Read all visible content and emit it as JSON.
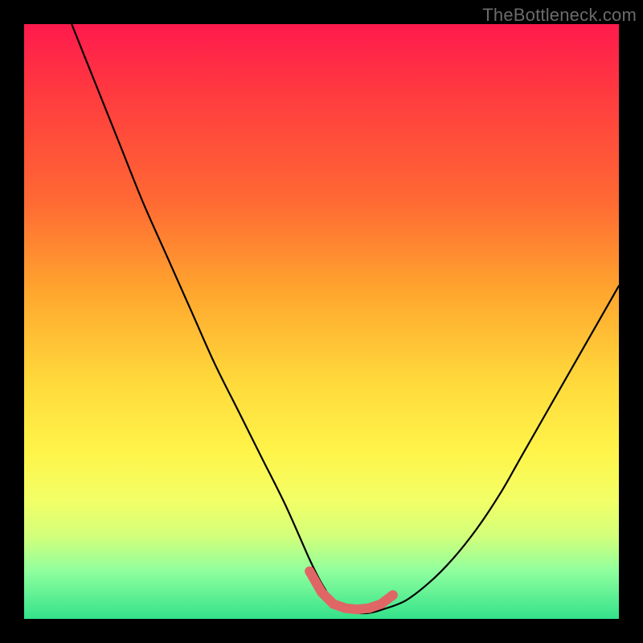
{
  "attribution": "TheBottleneck.com",
  "chart_data": {
    "type": "line",
    "title": "",
    "xlabel": "",
    "ylabel": "",
    "xlim": [
      0,
      100
    ],
    "ylim": [
      0,
      100
    ],
    "background_gradient": {
      "top": "#ff1a4d",
      "bottom": "#33e28a",
      "stops": [
        {
          "pos": 0,
          "color": "#ff1a4d"
        },
        {
          "pos": 12,
          "color": "#ff3b3f"
        },
        {
          "pos": 30,
          "color": "#ff6a33"
        },
        {
          "pos": 45,
          "color": "#ffa62e"
        },
        {
          "pos": 60,
          "color": "#ffd93b"
        },
        {
          "pos": 72,
          "color": "#fff44a"
        },
        {
          "pos": 80,
          "color": "#f2ff66"
        },
        {
          "pos": 86,
          "color": "#d4ff7a"
        },
        {
          "pos": 92,
          "color": "#8fff9e"
        },
        {
          "pos": 100,
          "color": "#33e28a"
        }
      ]
    },
    "series": [
      {
        "name": "bottleneck-curve",
        "color": "#000000",
        "x": [
          8,
          12,
          16,
          20,
          24,
          28,
          32,
          36,
          40,
          44,
          48,
          50,
          52,
          54,
          56,
          58,
          60,
          64,
          68,
          72,
          76,
          80,
          84,
          88,
          92,
          96,
          100
        ],
        "y": [
          100,
          90,
          80,
          70,
          61,
          52,
          43,
          35,
          27,
          19,
          10,
          6,
          3,
          1.5,
          1,
          1,
          1.5,
          3,
          6,
          10,
          15,
          21,
          28,
          35,
          42,
          49,
          56
        ]
      }
    ],
    "markers": {
      "name": "optimal-range",
      "color": "#e06666",
      "radius": 6,
      "x": [
        48,
        50,
        52,
        54,
        56,
        58,
        60,
        62
      ],
      "y": [
        8,
        4.5,
        2.5,
        1.8,
        1.6,
        1.8,
        2.5,
        4
      ]
    }
  }
}
